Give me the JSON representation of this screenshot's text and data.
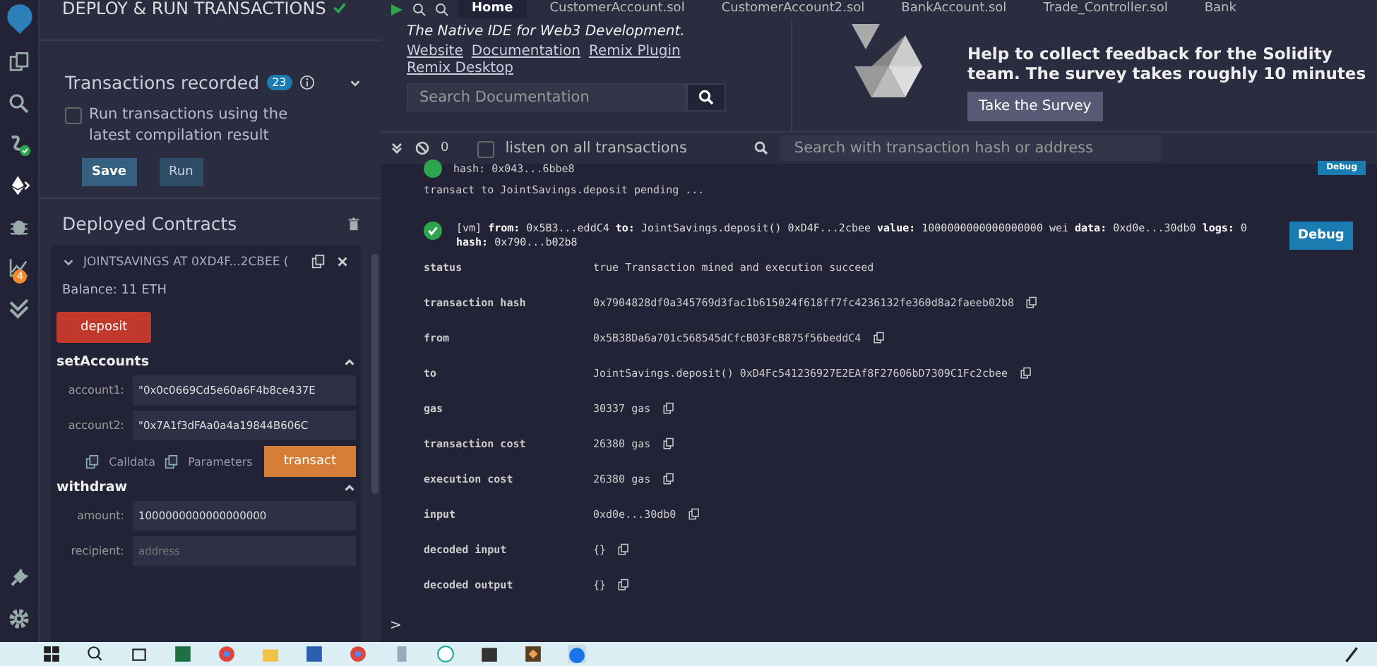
{
  "icon_bar": {
    "analytics_badge": "4"
  },
  "side_panel": {
    "title": "DEPLOY & RUN TRANSACTIONS",
    "recorder": {
      "label": "Transactions recorded",
      "count": "23",
      "expanded": false,
      "checkbox": {
        "label": "Run transactions using the latest compilation result",
        "checked": false
      },
      "buttons": [
        "Save",
        "Run"
      ]
    },
    "deployed": {
      "title": "Deployed Contracts",
      "contract": {
        "name": "JOINTSAVINGS AT 0XD4F...2CBEE (",
        "expanded": true,
        "balance": "Balance: 11 ETH",
        "functions": [
          {
            "kind": "button",
            "label": "deposit"
          },
          {
            "kind": "form",
            "name": "setAccounts",
            "expanded": true,
            "fields": [
              {
                "label": "account1:",
                "value": "\"0x0c0669Cd5e60a6F4b8ce437E"
              },
              {
                "label": "account2:",
                "value": "\"0x7A1f3dFAa0a4a19844B606C"
              }
            ],
            "actions": [
              "Calldata",
              "Parameters"
            ],
            "button": "transact"
          },
          {
            "kind": "form",
            "name": "withdraw",
            "expanded": true,
            "fields": [
              {
                "label": "amount:",
                "value": "1000000000000000000"
              },
              {
                "label": "recipient:",
                "placeholder": "address"
              }
            ]
          }
        ]
      }
    }
  },
  "tabs": [
    {
      "label": "Home",
      "selected": true
    },
    {
      "label": "CustomerAccount.sol",
      "selected": false
    },
    {
      "label": "CustomerAccount2.sol",
      "selected": false
    },
    {
      "label": "BankAccount.sol",
      "selected": false
    },
    {
      "label": "Trade_Controller.sol",
      "selected": false
    },
    {
      "label": "Bank",
      "selected": false
    }
  ],
  "home": {
    "tagline": "The Native IDE for Web3 Development.",
    "links": [
      "Website",
      "Documentation",
      "Remix Plugin",
      "Remix Desktop"
    ],
    "search": {
      "placeholder": "Search Documentation"
    },
    "survey": {
      "text": "Help to collect feedback for the Solidity team. The survey takes roughly 10 minutes",
      "button": "Take the Survey"
    }
  },
  "terminal": {
    "count": "0",
    "listen": {
      "label": "listen on all transactions",
      "checked": false
    },
    "search": {
      "placeholder": "Search with transaction hash or address"
    },
    "log": [
      {
        "kind": "hash",
        "text": "hash: 0x043...6bbe8",
        "debug": "Debug"
      },
      {
        "kind": "text",
        "text": "transact to JointSavings.deposit pending ..."
      },
      {
        "kind": "tx",
        "text": "[vm]  **from:** 0x5B3...eddC4 **to:** JointSavings.deposit() 0xD4F...2cbee **value:** 1000000000000000000 wei **data:** 0xd0e...30db0 **logs:** 0 **hash:** 0x790...b02b8",
        "debug": "Debug",
        "details": [
          {
            "key": "status",
            "value": "true Transaction mined and execution succeed",
            "copy": false
          },
          {
            "key": "transaction hash",
            "value": "0x7904828df0a345769d3fac1b615024f618ff7fc4236132fe360d8a2faeeb02b8",
            "copy": true
          },
          {
            "key": "from",
            "value": "0x5B38Da6a701c568545dCfcB03FcB875f56beddC4",
            "copy": true
          },
          {
            "key": "to",
            "value": "JointSavings.deposit() 0xD4Fc541236927E2EAf8F27606bD7309C1Fc2cbee",
            "copy": true
          },
          {
            "key": "gas",
            "value": "30337 gas",
            "copy": true
          },
          {
            "key": "transaction cost",
            "value": "26380 gas",
            "copy": true
          },
          {
            "key": "execution cost",
            "value": "26380 gas",
            "copy": true
          },
          {
            "key": "input",
            "value": "0xd0e...30db0",
            "copy": true
          },
          {
            "key": "decoded input",
            "value": "{}",
            "copy": true
          },
          {
            "key": "decoded output",
            "value": "{}",
            "copy": true
          }
        ]
      }
    ],
    "prompt": ">"
  }
}
